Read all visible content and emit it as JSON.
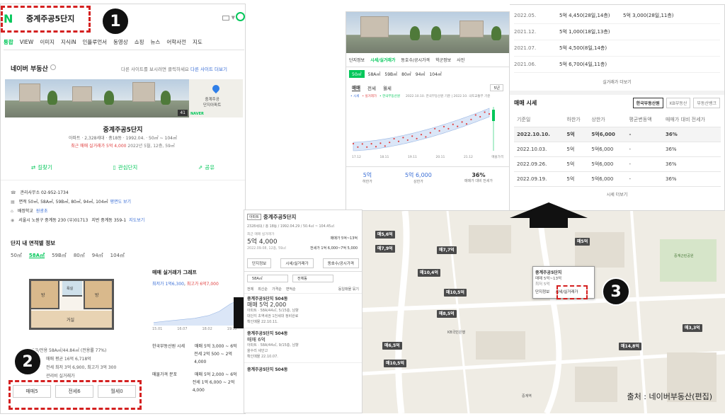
{
  "left": {
    "logo": "N",
    "search_text": "중계주공5단지",
    "nav_tabs": [
      "통합",
      "VIEW",
      "이미지",
      "지식iN",
      "인플루언서",
      "동영상",
      "쇼핑",
      "뉴스",
      "어학사전",
      "지도"
    ],
    "section_title": "네이버 부동산",
    "notice": "다른 사이트를 보시려면 클릭하세요",
    "notice_link": "다른 사이트 더보기",
    "photo_badge": "41",
    "pin_label": "중계주공\n단지아파트",
    "naver_badge": "NAVER",
    "complex_name": "중계주공5단지",
    "complex_info": "아파트 · 2,328세대 · 총18동 · 1992.04. · 50㎡ ~ 104㎡",
    "recent_trade": "최근 매매 실거래가 5억 4,000",
    "recent_trade_date": "2022년 5월, 12층, 59㎡",
    "actions": [
      "길찾기",
      "관심단지",
      "공유"
    ],
    "office_phone": "관리사무소 02-952-1734",
    "area_info": "면적 50㎡, 58A㎡, 59B㎡, 80㎡, 94㎡, 104㎡",
    "area_link": "평면도 보기",
    "school": "배정학교",
    "school_link": "원광초",
    "address": "서울시 노원구 중계동 230 (우)01713",
    "address_extra": "지번  중계동 359-1",
    "map_link": "지도보기",
    "area_section_title": "단지 내 면적별 정보",
    "sizes": [
      "50㎡",
      "58A㎡",
      "59B㎡",
      "80㎡",
      "94㎡",
      "104㎡"
    ],
    "floor_labels": [
      "방",
      "방",
      "욕실",
      "거실",
      "현관"
    ],
    "graph_title": "매매 실거래가 그래프",
    "graph_low": "최저가 1억6,300",
    "graph_high": "최고가 6억7,000",
    "graph_ticks": [
      "15.01",
      "16.07",
      "18.02",
      "19.12"
    ],
    "spec_area": "공급/전용 58A㎡/44.84㎡ (전용률 77%)",
    "spec_sale": "매매 평균 16억 6,718억",
    "spec_rent": "전세 최저 3억 6,900, 최고가 3억 300",
    "spec_more": "관리비 실거래가",
    "market_label": "한국부동산원 시세",
    "market_sale": "매매 5억 3,000 ~ 6억",
    "market_jeonse": "전세 2억 500 ~ 2억 4,000",
    "listing_label": "매물가격 분포",
    "listing_sale": "매매 5억 2,000 ~ 6억",
    "listing_jeonse": "전세 1억 6,000 ~ 2억 4,000",
    "deal_buttons": [
      "매매5",
      "전세6",
      "월세0"
    ]
  },
  "markers": [
    "1",
    "2",
    "3"
  ],
  "top_right": {
    "detail_tabs": [
      "단지정보",
      "시세/실거래가",
      "동호수/공시가격",
      "학군정보",
      "사진"
    ],
    "sizes": [
      "50㎡",
      "58A㎡",
      "59B㎡",
      "80㎡",
      "94㎡",
      "104㎡"
    ],
    "sub_tabs": [
      "매매",
      "전세",
      "월세"
    ],
    "period": "5년",
    "legend": [
      "• 시세",
      "• 실거래가",
      "• 한국부동산원"
    ],
    "source_note": "2022.10.10. 한국부동산원 기준 | 2022.10. 국토교통부 기준",
    "y_ticks": [
      "6.1억",
      "1.7억"
    ],
    "x_ticks": [
      "17.12",
      "18.11",
      "19.11",
      "20.11",
      "21.12",
      "매물가격"
    ],
    "summary": [
      {
        "value": "5억",
        "label": "하한가"
      },
      {
        "value": "5억 6,000",
        "label": "상한가"
      },
      {
        "value": "36%",
        "label": "매매가 대비 전세가"
      }
    ],
    "trades": [
      {
        "date": "2022.05.",
        "a": "5억 4,450(28일,14층)",
        "b": "5억 3,000(28일,11층)"
      },
      {
        "date": "2021.12.",
        "a": "5억 1,000(18일,13층)",
        "b": ""
      },
      {
        "date": "2021.07.",
        "a": "5억 4,500(8일,14층)",
        "b": ""
      },
      {
        "date": "2021.06.",
        "a": "5억 6,700(4일,11층)",
        "b": ""
      }
    ],
    "trades_more": "실거래가 더보기",
    "market_title": "매매 시세",
    "market_sources": [
      "한국부동산원",
      "KB부동산",
      "부동산뱅크"
    ],
    "market_headers": [
      "기준일",
      "하한가",
      "상한가",
      "평균변동액",
      "매매가 대비 전세가"
    ],
    "market_rows": [
      [
        "2022.10.10.",
        "5억",
        "5억6,000",
        "-",
        "36%"
      ],
      [
        "2022.10.03.",
        "5억",
        "5억6,000",
        "-",
        "36%"
      ],
      [
        "2022.09.26.",
        "5억",
        "5억6,000",
        "-",
        "36%"
      ],
      [
        "2022.09.19.",
        "5억",
        "5억6,000",
        "-",
        "36%"
      ]
    ],
    "market_more": "시세 더보기"
  },
  "listing": {
    "badge": "아파트",
    "title": "중계주공5단지",
    "info": "2328세대 / 총 18동 / 1992.04.29 / 50.4㎡ ~ 104.45㎡",
    "recent_label": "최근 매매 실거래가",
    "recent_price": "5억 4,000",
    "recent_date": "2022.09.08, 12층, 59㎡",
    "sale_range": "매매가 5억~13억",
    "jeonse_range": "전세가 1억 6,000~7억 5,000",
    "tabs": [
      "단지정보",
      "시세/실거래가",
      "동호수/공시가격"
    ],
    "filter_size": "58A㎡",
    "filter_type": "전체동",
    "filters": [
      "전체",
      "최신순",
      "가격순",
      "면적순"
    ],
    "filter_more": "동일매물 묶기",
    "items": [
      {
        "title": "중계주공5단지 504동",
        "price": "매매 5억 2,000",
        "spec": "아파트 · 58A/44㎡, 5/15층, 남향",
        "desc": "대단지 초역세권 1천세대 정비완료",
        "date": "확인매물 22.10.11."
      },
      {
        "title": "중계주공5단지 504동",
        "price": "매매 6억",
        "spec": "아파트 · 58A/44㎡, 9/15층, 남향",
        "desc": "올수리 세안고",
        "date": "확인매물 22.10.07."
      },
      {
        "title": "중계주공5단지 504동",
        "price": "",
        "spec": "",
        "desc": "",
        "date": ""
      }
    ]
  },
  "map": {
    "popup_title": "중계주공5단지",
    "popup_price": "매매 5억~13억",
    "popup_sub": "최저 5억",
    "popup_buttons": [
      "단지정보",
      "시세/실거래가"
    ],
    "markers": [
      "매5,6억",
      "매7,9억",
      "매7,7억",
      "매10,4억",
      "매10,5억",
      "매8,5억",
      "매6,5억",
      "매10,5억",
      "매3,3억",
      "매14,8억",
      "매5억"
    ],
    "labels": [
      "중계역",
      "KB국민은행",
      "중계근린공원"
    ],
    "source": "출처 : 네이버부동산(편집)"
  }
}
